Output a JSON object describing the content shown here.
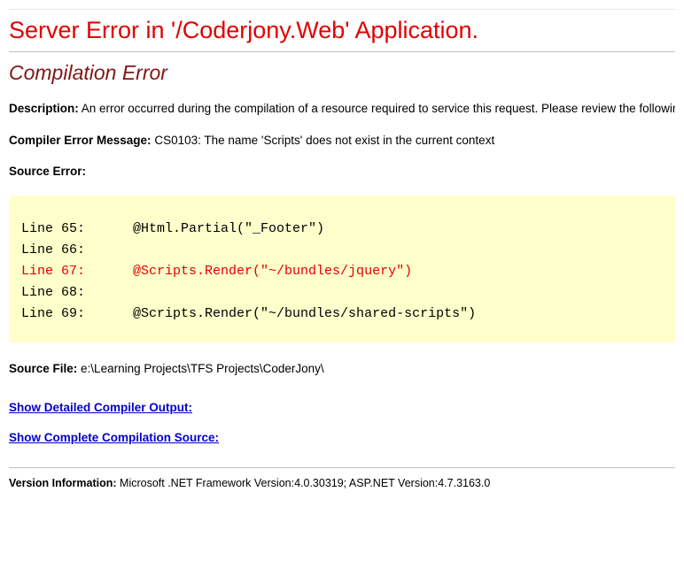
{
  "title": "Server Error in '/Coderjony.Web' Application.",
  "subtitle": "Compilation Error",
  "description": {
    "label": "Description:",
    "text": "An error occurred during the compilation of a resource required to service this request. Please review the following specific error details and modify your source code appropriately."
  },
  "compiler_error": {
    "label": "Compiler Error Message:",
    "text": "CS0103: The name 'Scripts' does not exist in the current context"
  },
  "source_error_label": "Source Error:",
  "source_lines": [
    {
      "num": "Line 65:",
      "code": "@Html.Partial(\"_Footer\")",
      "highlight": false
    },
    {
      "num": "Line 66:",
      "code": "",
      "highlight": false
    },
    {
      "num": "Line 67:",
      "code": "@Scripts.Render(\"~/bundles/jquery\")",
      "highlight": true
    },
    {
      "num": "Line 68:",
      "code": "",
      "highlight": false
    },
    {
      "num": "Line 69:",
      "code": "@Scripts.Render(\"~/bundles/shared-scripts\")",
      "highlight": false
    }
  ],
  "source_file": {
    "label": "Source File:",
    "path": "e:\\Learning Projects\\TFS Projects\\CoderJony\\"
  },
  "links": {
    "detailed_output": "Show Detailed Compiler Output:",
    "compilation_source": "Show Complete Compilation Source:"
  },
  "version": {
    "label": "Version Information:",
    "text": "Microsoft .NET Framework Version:4.0.30319; ASP.NET Version:4.7.3163.0"
  }
}
